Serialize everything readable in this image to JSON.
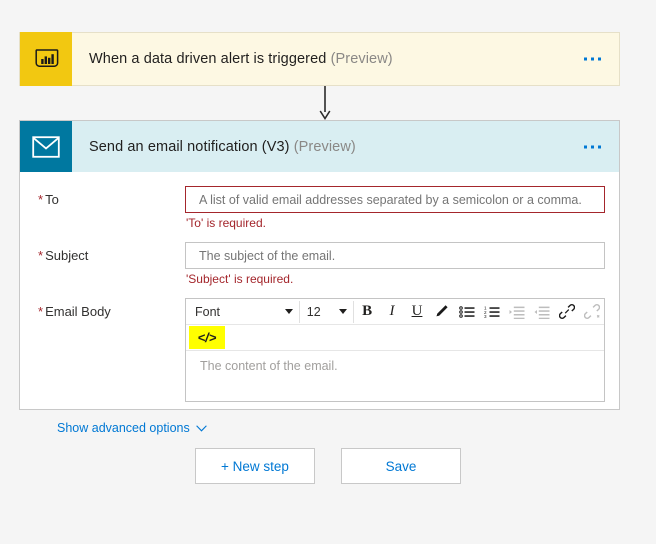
{
  "trigger_card": {
    "icon": "powerbi-icon",
    "title": "When a data driven alert is triggered",
    "preview_label": "(Preview)",
    "menu_icon": "ellipsis-icon",
    "background_color": "#fdf8e3",
    "icon_background": "#f2c811"
  },
  "connector": {
    "icon": "down-arrow-icon"
  },
  "action_card": {
    "icon": "envelope-icon",
    "title": "Send an email notification (V3)",
    "preview_label": "(Preview)",
    "menu_icon": "ellipsis-icon",
    "header_background": "#d9eef2",
    "icon_background": "#0078a0",
    "fields": {
      "to": {
        "label": "To",
        "required_marker": "*",
        "placeholder": "A list of valid email addresses separated by a semicolon or a comma.",
        "value": "",
        "error": "'To' is required.",
        "error_color": "#a4262c"
      },
      "subject": {
        "label": "Subject",
        "required_marker": "*",
        "placeholder": "The subject of the email.",
        "value": "",
        "error": "'Subject' is required.",
        "error_color": "#a4262c"
      },
      "email_body": {
        "label": "Email Body",
        "required_marker": "*",
        "placeholder": "The content of the email.",
        "value": "",
        "toolbar": {
          "font_family": "Font",
          "font_size": "12",
          "bold": "B",
          "italic": "I",
          "underline": "U",
          "text_color_icon": "pen-icon",
          "bulleted_list_icon": "bulleted-list-icon",
          "numbered_list_icon": "numbered-list-icon",
          "indent_icon": "indent-icon",
          "outdent_icon": "outdent-icon",
          "link_icon": "link-icon",
          "unlink_icon": "unlink-icon",
          "code_view": "</>",
          "code_view_highlight": "#ffff00"
        }
      }
    },
    "advanced_options": {
      "label": "Show advanced options",
      "chevron_icon": "chevron-down-icon",
      "color": "#0078d4"
    }
  },
  "bottom_actions": {
    "new_step": "+ New step",
    "save": "Save",
    "link_color": "#0078d4"
  }
}
